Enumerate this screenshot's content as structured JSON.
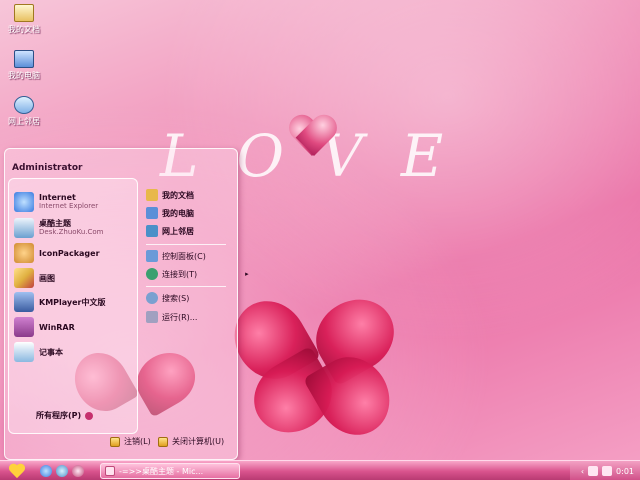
{
  "desktop": {
    "icons": [
      {
        "label": "我的文档",
        "icon": "folder-icon"
      },
      {
        "label": "我的电脑",
        "icon": "computer-icon"
      },
      {
        "label": "网上邻居",
        "icon": "network-icon"
      }
    ]
  },
  "wallpaper": {
    "word": "LOVE"
  },
  "start_menu": {
    "user": "Administrator",
    "programs": [
      {
        "name": "Internet",
        "sub": "Internet Explorer",
        "icon": "ie-icon",
        "color": "#3a7be0"
      },
      {
        "name": "桌酷主题",
        "sub": "Desk.ZhuoKu.Com",
        "icon": "theme-icon",
        "color": "#6aa0d0"
      },
      {
        "name": "IconPackager",
        "sub": "",
        "icon": "iconpackager-icon",
        "color": "#d08a30"
      },
      {
        "name": "画图",
        "sub": "",
        "icon": "paint-icon",
        "color": "#e0b040"
      },
      {
        "name": "KMPlayer中文版",
        "sub": "",
        "icon": "kmplayer-icon",
        "color": "#3a5ca0"
      },
      {
        "name": "WinRAR",
        "sub": "",
        "icon": "winrar-icon",
        "color": "#8a3a8a"
      },
      {
        "name": "记事本",
        "sub": "",
        "icon": "notepad-icon",
        "color": "#8ab8e0"
      }
    ],
    "all_programs": "所有程序(P)",
    "places": [
      {
        "label": "我的文档",
        "icon": "folder-icon",
        "color": "#e8b84a"
      },
      {
        "label": "我的电脑",
        "icon": "computer-icon",
        "color": "#5b8fd8"
      },
      {
        "label": "网上邻居",
        "icon": "network-icon",
        "color": "#4a90c8"
      }
    ],
    "system": [
      {
        "label": "控制面板(C)",
        "icon": "control-panel-icon",
        "color": "#6a9ad8"
      },
      {
        "label": "连接到(T)",
        "icon": "connect-icon",
        "color": "#3aa070"
      }
    ],
    "tools": [
      {
        "label": "搜索(S)",
        "icon": "search-icon",
        "color": "#7aa0d0"
      },
      {
        "label": "运行(R)...",
        "icon": "run-icon",
        "color": "#a0a0c0"
      }
    ],
    "logoff": "注销(L)",
    "shutdown": "关闭计算机(U)"
  },
  "taskbar": {
    "task_label": "-=>>桌酷主题 - Mic...",
    "clock": "0:01"
  }
}
